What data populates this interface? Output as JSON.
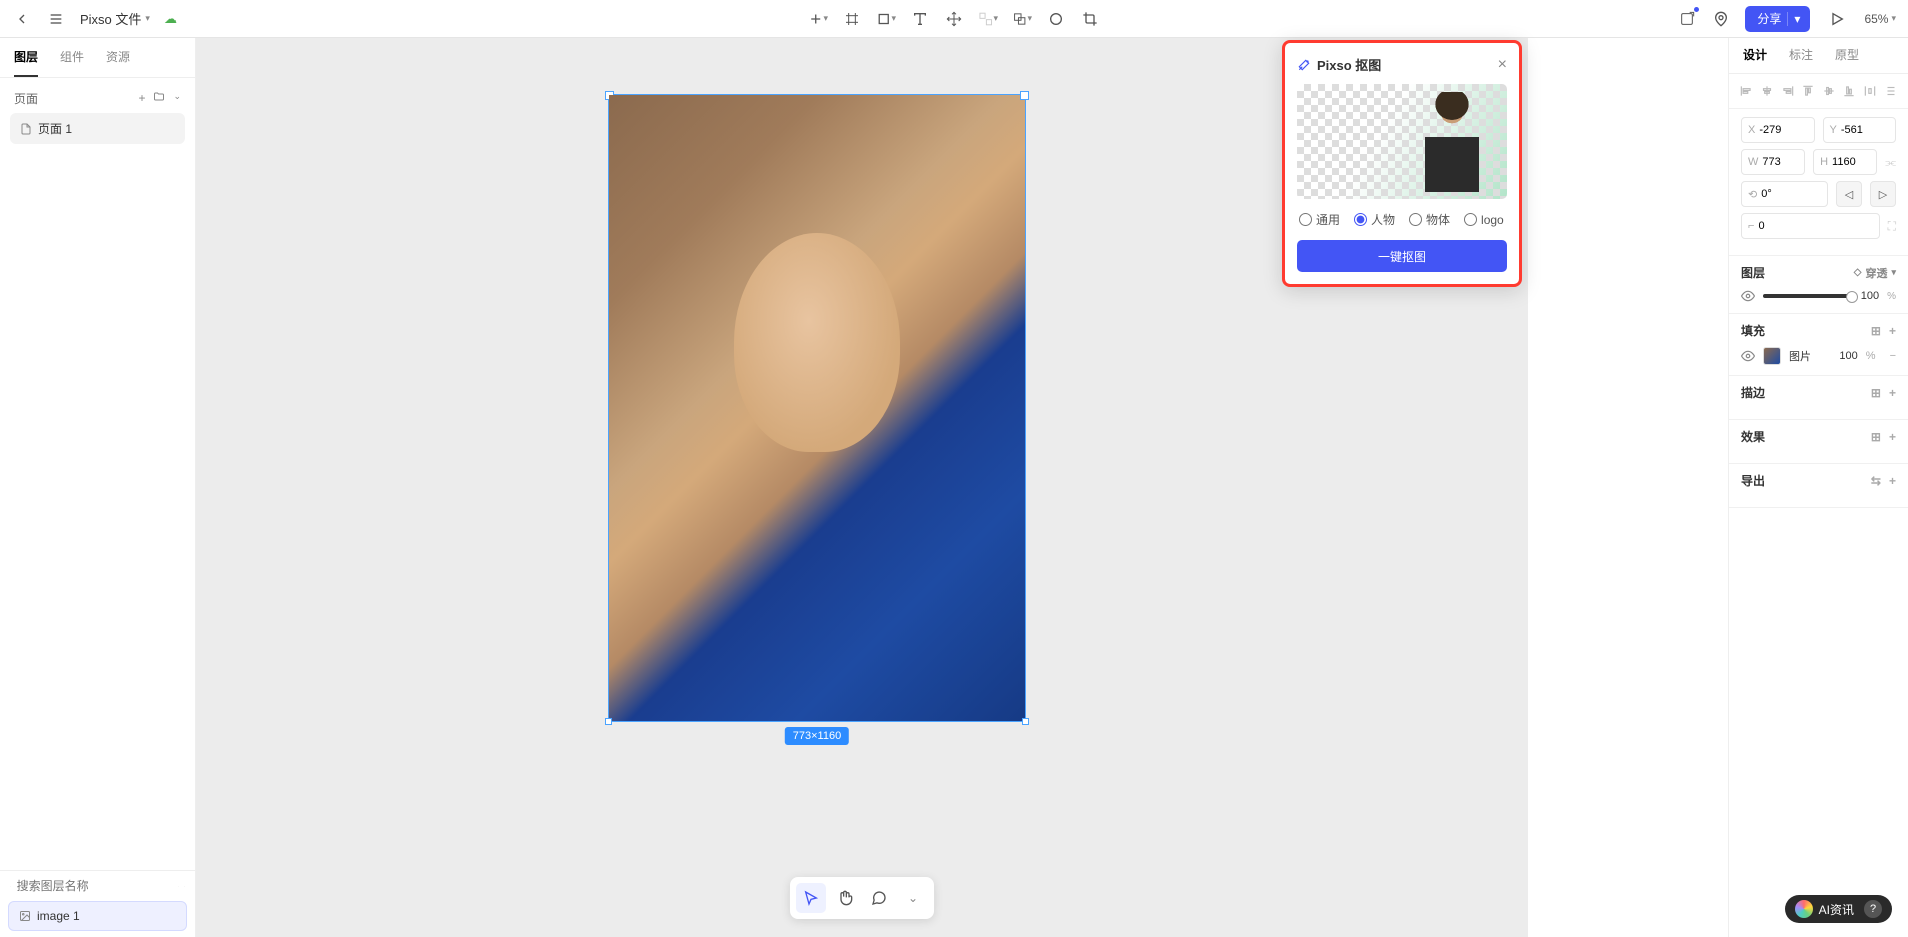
{
  "topbar": {
    "file_title": "Pixso 文件",
    "share_label": "分享",
    "zoom": "65%"
  },
  "left_panel": {
    "tabs": [
      "图层",
      "组件",
      "资源"
    ],
    "active_tab": 0,
    "pages_label": "页面",
    "pages": [
      "页面 1"
    ],
    "search_placeholder": "搜索图层名称",
    "layers": [
      "image 1"
    ]
  },
  "canvas": {
    "selection_dims": "773×1160"
  },
  "koutu": {
    "title": "Pixso 抠图",
    "options": [
      "通用",
      "人物",
      "物体",
      "logo"
    ],
    "selected_option": 1,
    "button": "一键抠图"
  },
  "right_panel": {
    "tabs": [
      "设计",
      "标注",
      "原型"
    ],
    "active_tab": 0,
    "x": "-279",
    "y": "-561",
    "w": "773",
    "h": "1160",
    "rotation": "0°",
    "radius": "0",
    "layer_label": "图层",
    "pass_through": "穿透",
    "opacity": "100",
    "opacity_pct": "%",
    "fill_label": "填充",
    "fill_type": "图片",
    "fill_opacity": "100",
    "fill_pct": "%",
    "stroke_label": "描边",
    "effect_label": "效果",
    "export_label": "导出"
  },
  "badge": {
    "text": "AI资讯",
    "q": "?"
  }
}
